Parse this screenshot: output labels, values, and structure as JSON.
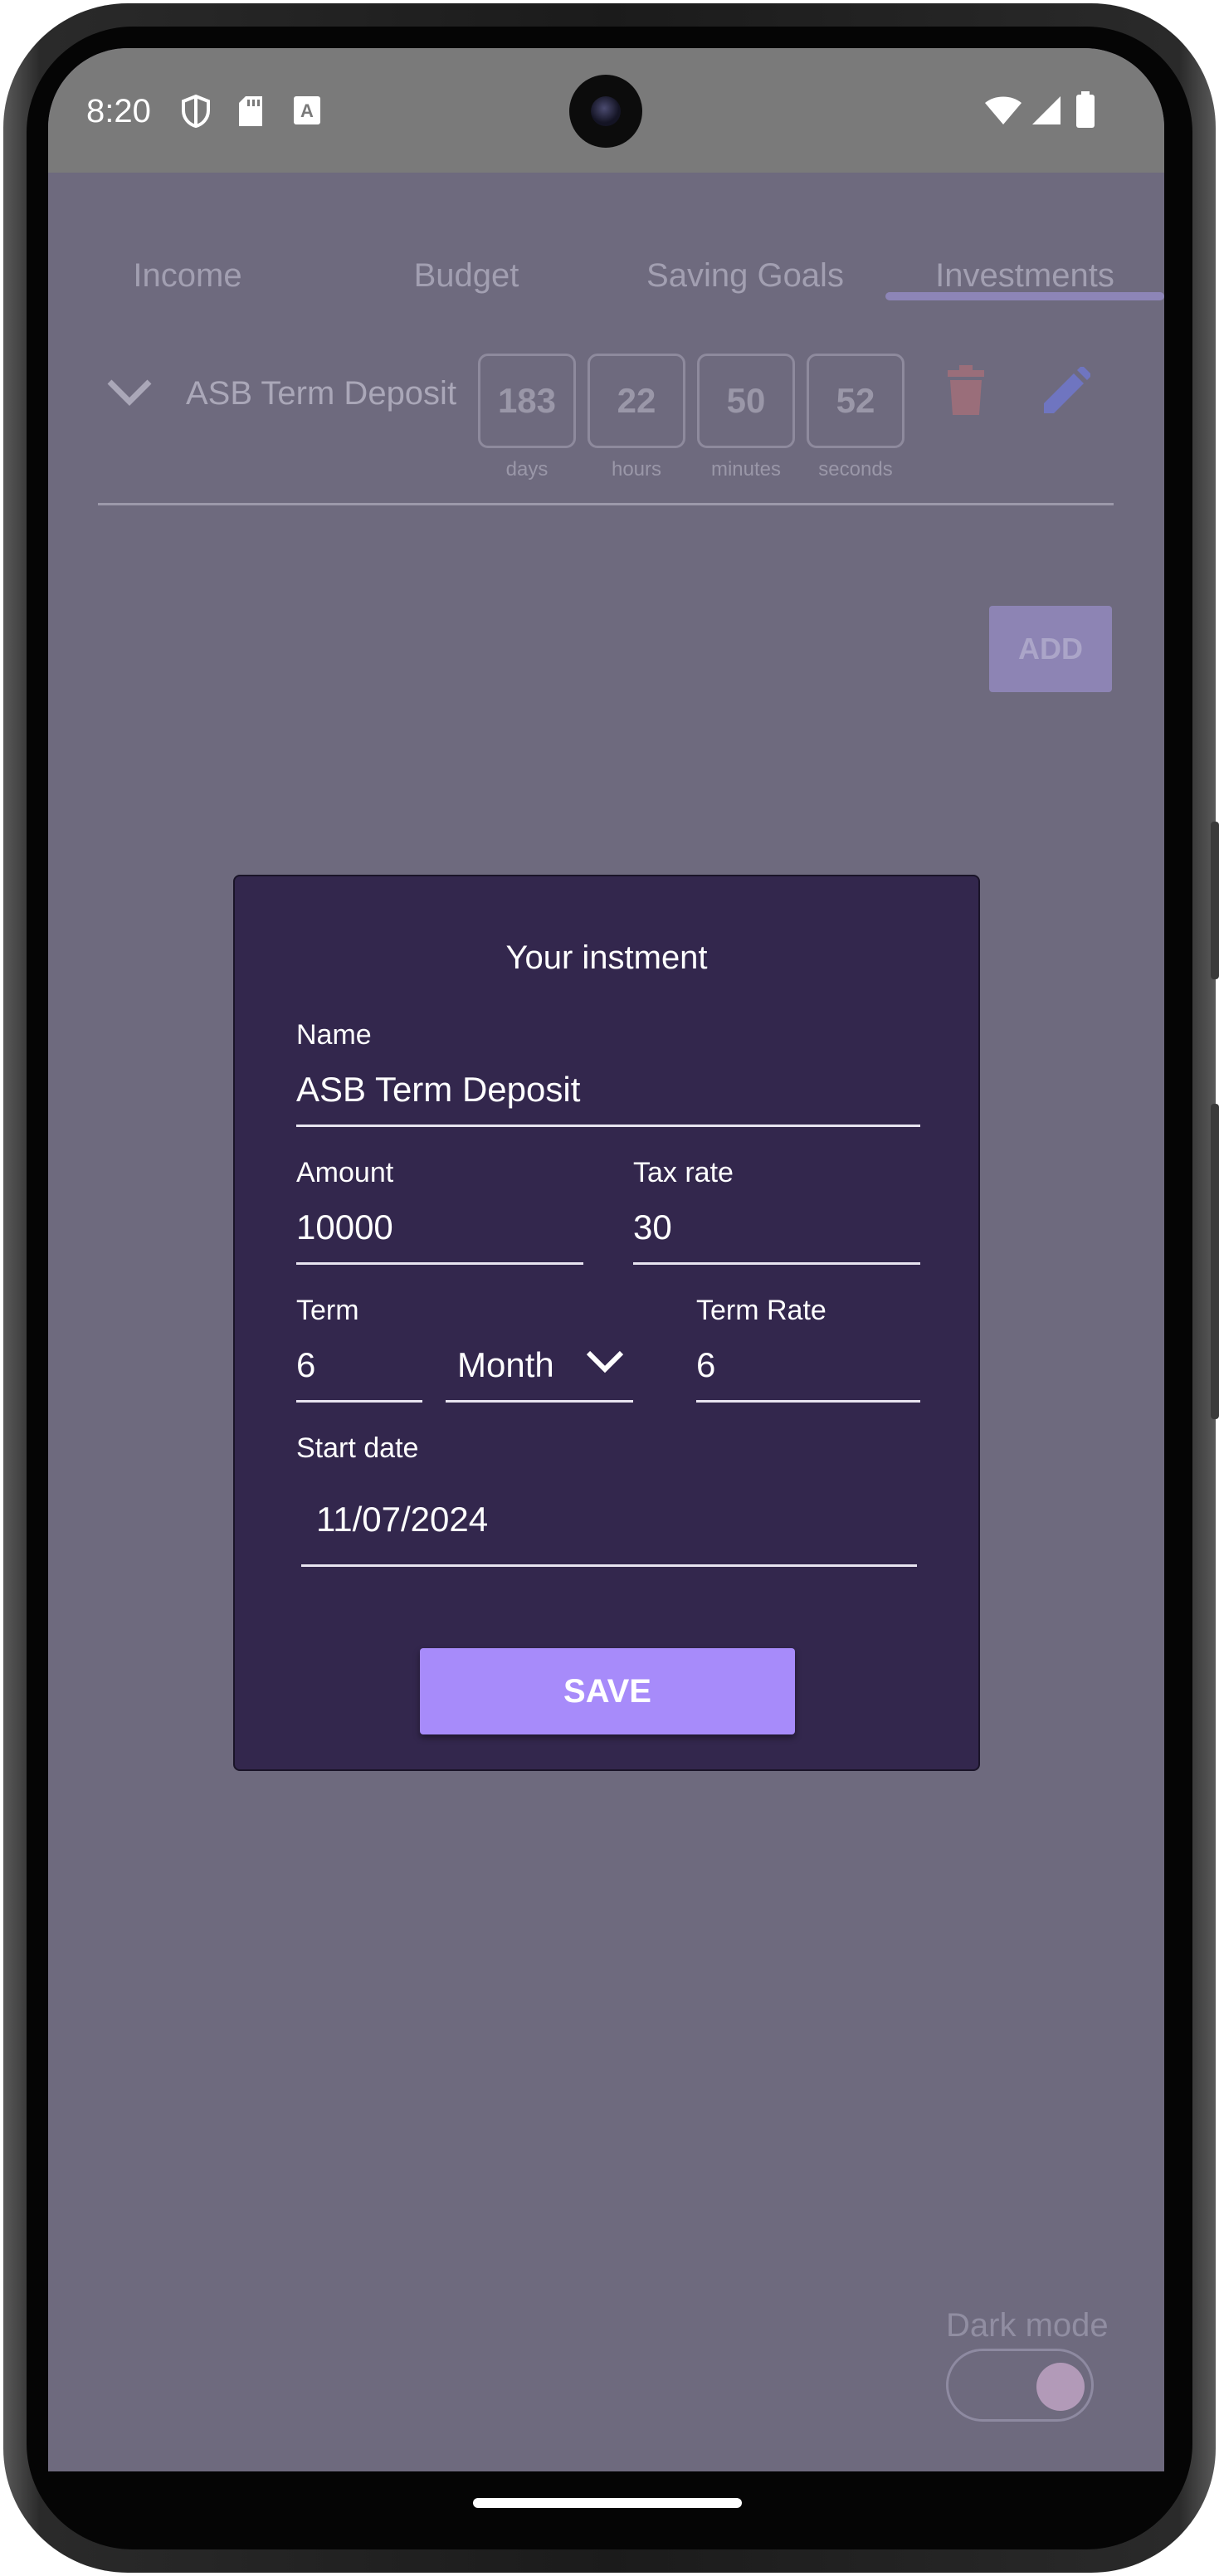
{
  "status_bar": {
    "time": "8:20",
    "left_icons": [
      "shield-icon",
      "sd-card-icon",
      "text-icon"
    ],
    "right_icons": [
      "wifi-icon",
      "signal-icon",
      "battery-icon"
    ]
  },
  "tabs": [
    {
      "label": "Income"
    },
    {
      "label": "Budget"
    },
    {
      "label": "Saving Goals"
    },
    {
      "label": "Investments",
      "selected": true
    }
  ],
  "investment": {
    "name": "ASB Term Deposit",
    "countdown": [
      {
        "value": "183",
        "unit": "days"
      },
      {
        "value": "22",
        "unit": "hours"
      },
      {
        "value": "50",
        "unit": "minutes"
      },
      {
        "value": "52",
        "unit": "seconds"
      }
    ]
  },
  "add_label": "ADD",
  "dialog": {
    "title": "Your instment",
    "name_label": "Name",
    "name_value": "ASB Term Deposit",
    "amount_label": "Amount",
    "amount_value": "10000",
    "tax_label": "Tax rate",
    "tax_value": "30",
    "term_label": "Term",
    "term_value": "6",
    "term_unit": "Month",
    "term_rate_label": "Term Rate",
    "term_rate_value": "6",
    "start_date_label": "Start date",
    "start_date_value": "11/07/2024",
    "save_label": "SAVE"
  },
  "dark_mode": {
    "label": "Dark mode",
    "enabled": true
  },
  "colors": {
    "overlay": "#6e6a7e",
    "dialog_bg": "#33274d",
    "save_button": "#a78bfa",
    "tab_indicator": "#8d85b7",
    "delete_icon": "#9a6e7a",
    "edit_icon": "#6f75c0"
  }
}
